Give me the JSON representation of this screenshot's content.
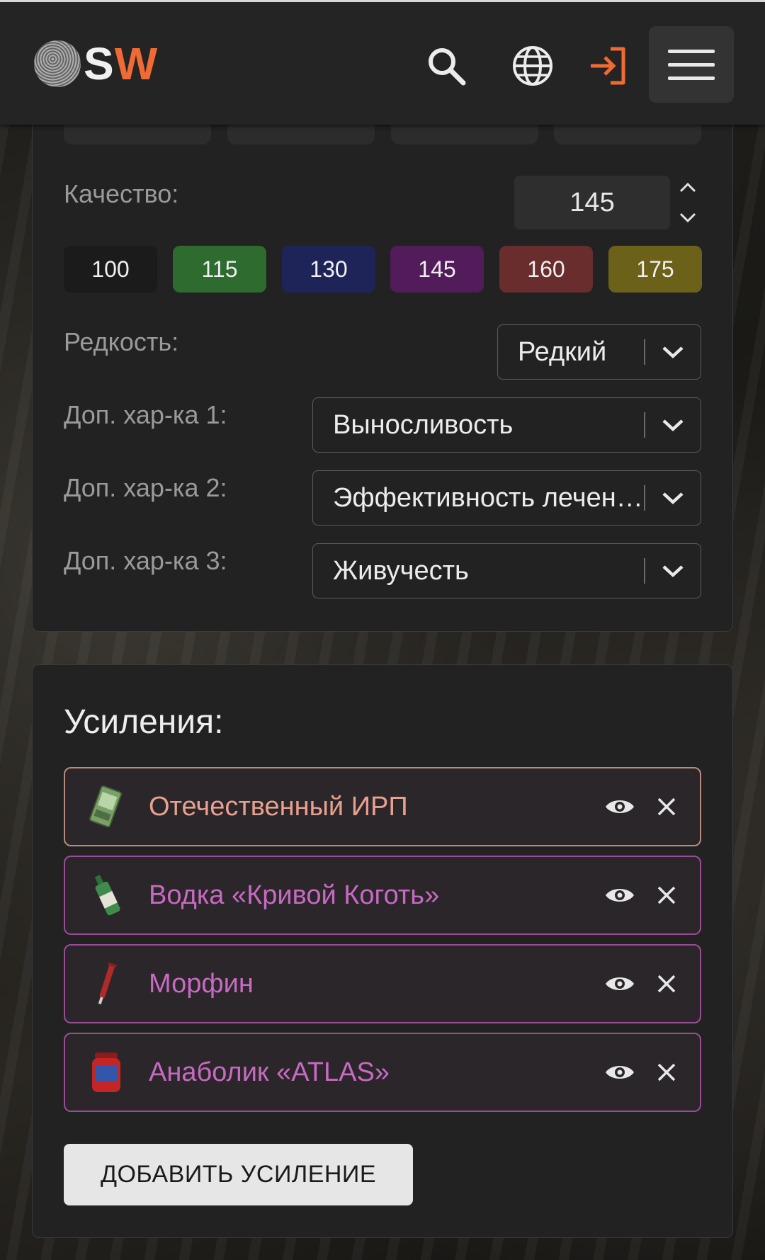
{
  "header": {
    "logo_s": "S",
    "logo_w": "W",
    "icons": [
      "search-icon",
      "globe-icon",
      "login-icon",
      "menu-icon"
    ],
    "accent_color": "#f06a35"
  },
  "params": {
    "quality": {
      "label": "Качество:",
      "value": "145",
      "presets": [
        {
          "label": "100",
          "color": "#1b1b1b"
        },
        {
          "label": "115",
          "color": "#2e6b2e"
        },
        {
          "label": "130",
          "color": "#1e2458"
        },
        {
          "label": "145",
          "color": "#521c5a"
        },
        {
          "label": "160",
          "color": "#6a2d2d"
        },
        {
          "label": "175",
          "color": "#6b6118"
        }
      ]
    },
    "rarity": {
      "label": "Редкость:",
      "value": "Редкий"
    },
    "extra1": {
      "label": "Доп. хар-ка 1:",
      "value": "Выносливость"
    },
    "extra2": {
      "label": "Доп. хар-ка 2:",
      "value": "Эффективность лечения"
    },
    "extra3": {
      "label": "Доп. хар-ка 3:",
      "value": "Живучесть"
    }
  },
  "boosts": {
    "heading": "Усиления:",
    "items": [
      {
        "name": "Отечественный ИРП",
        "color": "#e8a08f",
        "border": "#b98a80",
        "icon": "ration-pack-icon"
      },
      {
        "name": "Водка «Кривой Коготь»",
        "color": "#c76ac2",
        "border": "#9b4c98",
        "icon": "vodka-bottle-icon"
      },
      {
        "name": "Морфин",
        "color": "#c76ac2",
        "border": "#9b4c98",
        "icon": "syringe-icon"
      },
      {
        "name": "Анаболик «ATLAS»",
        "color": "#c76ac2",
        "border": "#9b4c98",
        "icon": "supplement-jar-icon"
      }
    ],
    "add_label": "ДОБАВИТЬ УСИЛЕНИЕ"
  }
}
